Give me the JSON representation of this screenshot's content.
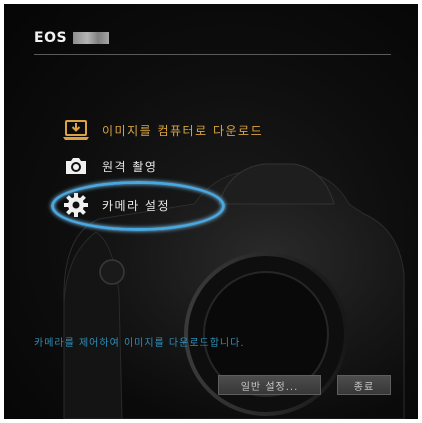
{
  "window": {
    "title": "EOS"
  },
  "menu": {
    "items": [
      {
        "label": "이미지를 컴퓨터로 다운로드",
        "icon": "laptop-download-icon",
        "color": "#d9a441"
      },
      {
        "label": "원격 촬영",
        "icon": "camera-icon",
        "color": "#e6e6e6"
      },
      {
        "label": "카메라 설정",
        "icon": "gear-icon",
        "color": "#e6e6e6"
      }
    ],
    "highlight_color": "#4aa8e0"
  },
  "status": {
    "text": "카메라를 제어하여 이미지를 다운로드합니다."
  },
  "footer": {
    "general_settings_label": "일반 설정...",
    "exit_label": "종료"
  }
}
